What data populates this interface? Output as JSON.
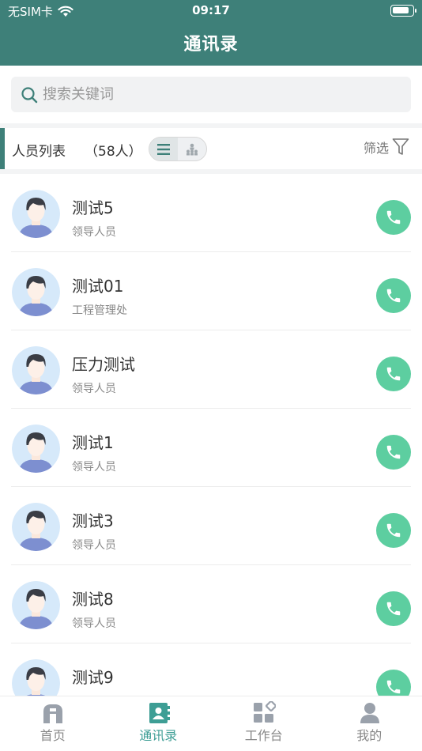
{
  "status": {
    "carrier": "无SIM卡",
    "time": "09:17"
  },
  "header": {
    "title": "通讯录"
  },
  "search": {
    "placeholder": "搜索关键词"
  },
  "list_header": {
    "title": "人员列表",
    "count": "（58人）",
    "filter_label": "筛选"
  },
  "contacts": [
    {
      "name": "测试5",
      "dept": "领导人员"
    },
    {
      "name": "测试01",
      "dept": "工程管理处"
    },
    {
      "name": "压力测试",
      "dept": "领导人员"
    },
    {
      "name": "测试1",
      "dept": "领导人员"
    },
    {
      "name": "测试3",
      "dept": "领导人员"
    },
    {
      "name": "测试8",
      "dept": "领导人员"
    },
    {
      "name": "测试9",
      "dept": ""
    }
  ],
  "tabs": [
    {
      "label": "首页",
      "icon": "home-icon"
    },
    {
      "label": "通讯录",
      "icon": "contacts-icon",
      "active": true
    },
    {
      "label": "工作台",
      "icon": "workbench-icon"
    },
    {
      "label": "我的",
      "icon": "profile-icon"
    }
  ],
  "colors": {
    "primary": "#3e8079",
    "call": "#5dcea0",
    "active_tab": "#3e9e95"
  }
}
